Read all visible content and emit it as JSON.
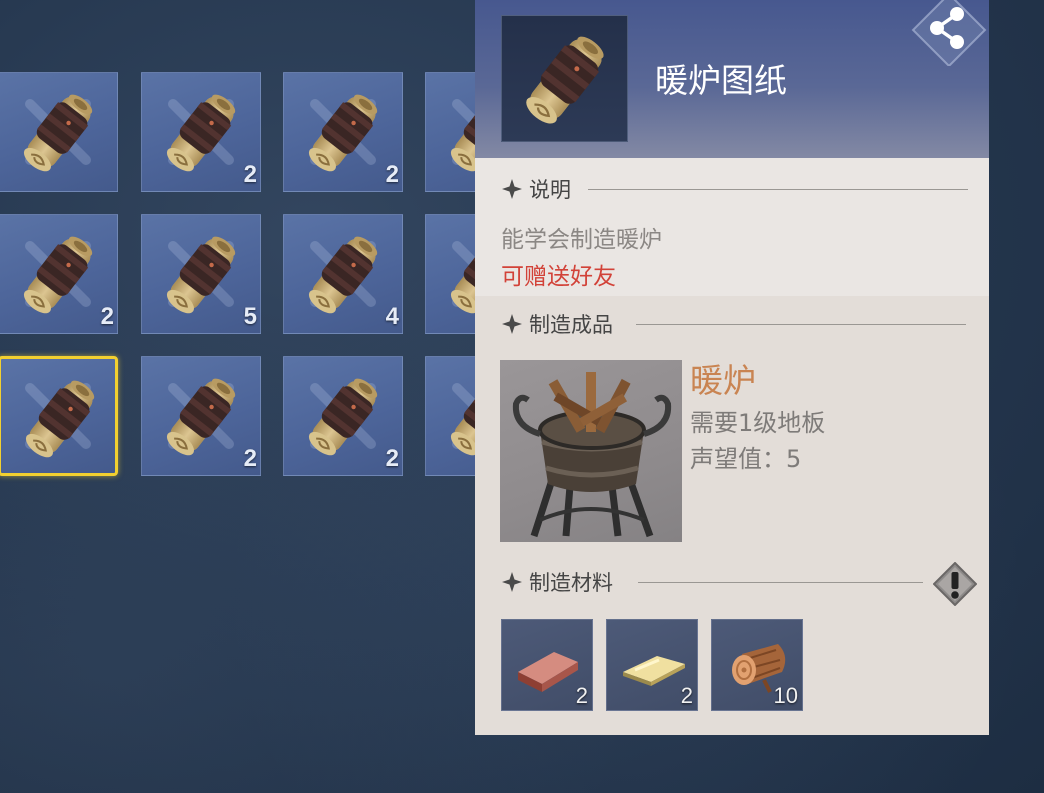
{
  "inventory": {
    "rows": [
      [
        {
          "count": ""
        },
        {
          "count": "2"
        },
        {
          "count": "2"
        },
        {
          "count": ""
        }
      ],
      [
        {
          "count": "2"
        },
        {
          "count": "5"
        },
        {
          "count": "4"
        },
        {
          "count": ""
        }
      ],
      [
        {
          "count": ""
        },
        {
          "count": "2"
        },
        {
          "count": "2"
        },
        {
          "count": ""
        }
      ]
    ],
    "selected_slot": "row3-col1",
    "item_icon": "blueprint-scroll-icon"
  },
  "detail": {
    "title": "暖炉图纸",
    "share_icon": "share-icon",
    "description": {
      "heading": "说明",
      "text": "能学会制造暖炉",
      "gift_note": "可赠送好友"
    },
    "product": {
      "heading": "制造成品",
      "name": "暖炉",
      "requirement": "需要1级地板",
      "prestige": "声望值：5"
    },
    "materials": {
      "heading": "制造材料",
      "alert_icon": "exclamation-icon",
      "items": [
        {
          "icon": "copper-ingot-icon",
          "count": "2"
        },
        {
          "icon": "gold-plate-icon",
          "count": "2"
        },
        {
          "icon": "wood-log-icon",
          "count": "10"
        }
      ]
    }
  },
  "colors": {
    "selected_border": "#f2d030",
    "gift_text": "#d24238",
    "product_name": "#c98452"
  }
}
